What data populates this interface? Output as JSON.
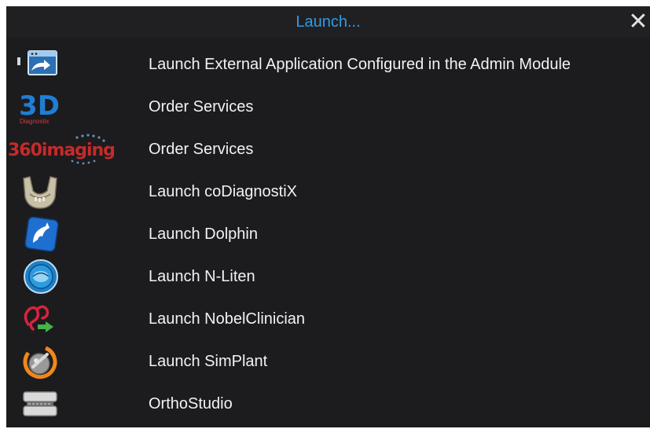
{
  "dialog": {
    "title": "Launch...",
    "close_glyph": "✕"
  },
  "items": [
    {
      "label": "Launch External Application Configured in the Admin Module",
      "icon": "external-app-icon"
    },
    {
      "label": "Order Services",
      "icon": "3d-diagnostix-logo-icon",
      "logo_text": "3D",
      "logo_subtext": "Diagnostix"
    },
    {
      "label": "Order Services",
      "icon": "360-imaging-logo-icon",
      "logo_text": "360imaging"
    },
    {
      "label": "Launch coDiagnostiX",
      "icon": "jaw-model-icon"
    },
    {
      "label": "Launch Dolphin",
      "icon": "dolphin-icon"
    },
    {
      "label": "Launch N-Liten",
      "icon": "n-liten-globe-icon"
    },
    {
      "label": "Launch NobelClinician",
      "icon": "nobelclinician-icon"
    },
    {
      "label": "Launch SimPlant",
      "icon": "simplant-icon"
    },
    {
      "label": "OrthoStudio",
      "icon": "orthostudio-icon"
    }
  ],
  "colors": {
    "background": "#1c1c1e",
    "title": "#2f9be6",
    "text": "#f2f2f2"
  }
}
